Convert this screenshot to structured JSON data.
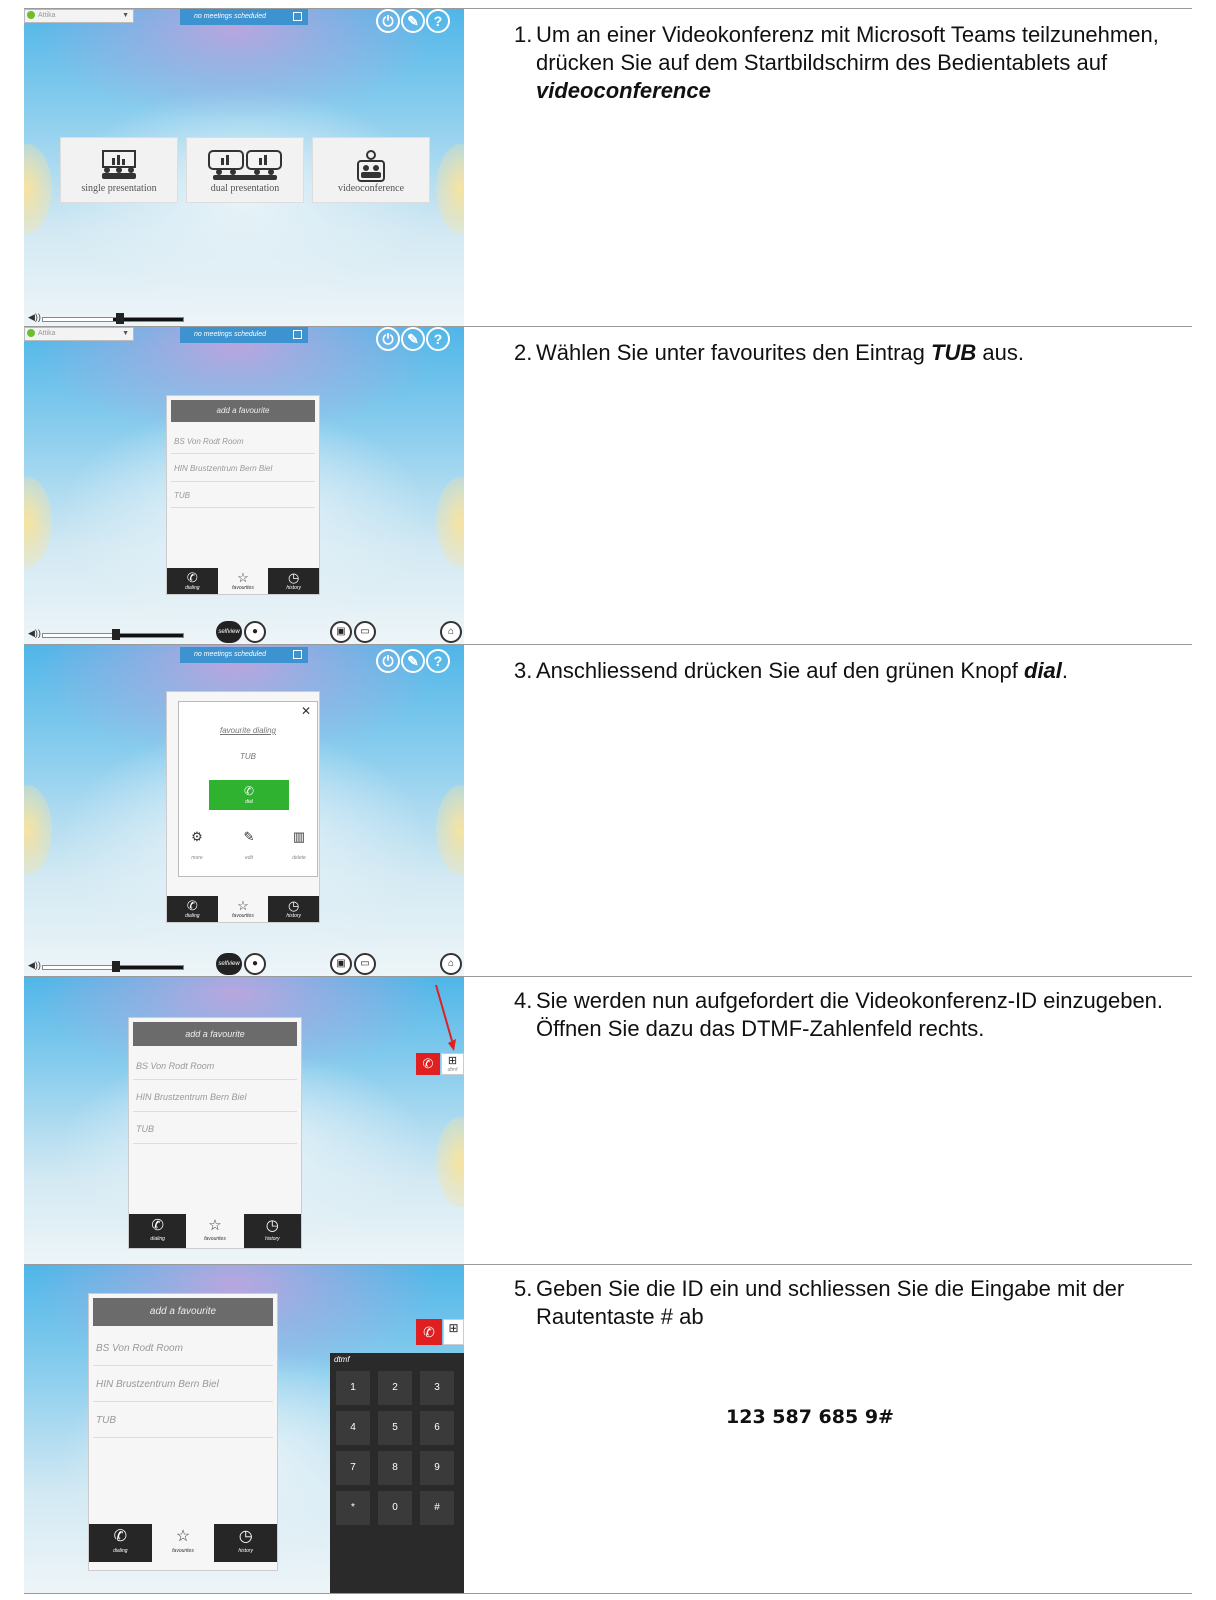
{
  "screens": {
    "room_label": "Attika",
    "meetings_label": "no meetings scheduled",
    "tiles": [
      "single presentation",
      "dual presentation",
      "videoconference"
    ],
    "favourites": {
      "add_label": "add a favourite",
      "items": [
        "BS Von Rodt Room",
        "HIN Brustzentrum Bern Biel",
        "TUB"
      ],
      "tabs": [
        "dialing",
        "favourites",
        "history"
      ]
    },
    "selfview_label": "selfview",
    "dialog": {
      "title": "favourite dialing",
      "entry": "TUB",
      "dial_label": "dial",
      "actions": [
        "more",
        "edit",
        "delete"
      ]
    },
    "dtmf": {
      "label": "dtmf",
      "keys": [
        "1",
        "2",
        "3",
        "4",
        "5",
        "6",
        "7",
        "8",
        "9",
        "*",
        "0",
        "#"
      ]
    }
  },
  "steps": [
    {
      "number": "1.",
      "parts": [
        "Um an einer Videokonferenz mit Microsoft Teams teilzunehmen, drücken Sie auf dem Startbildschirm des Bedientablets auf ",
        "videoconference",
        ""
      ]
    },
    {
      "number": "2.",
      "parts": [
        "Wählen Sie unter favourites den Eintrag ",
        "TUB",
        " aus."
      ]
    },
    {
      "number": "3.",
      "parts": [
        "Anschliessend drücken Sie auf den grünen Knopf ",
        "dial",
        "."
      ]
    },
    {
      "number": "4.",
      "parts": [
        "Sie werden nun aufgefordert die Videokonferenz-ID einzugeben. Öffnen Sie dazu das DTMF-Zahlenfeld rechts.",
        "",
        ""
      ]
    },
    {
      "number": "5.",
      "parts": [
        "Geben Sie die ID ein und schliessen Sie die Eingabe mit der Rautentaste # ab",
        "",
        ""
      ]
    }
  ],
  "id_example": "123 587 685 9#",
  "colors": {
    "dial_green": "#2fb22f",
    "call_red": "#e02020",
    "accent_blue": "#3d93cf"
  }
}
